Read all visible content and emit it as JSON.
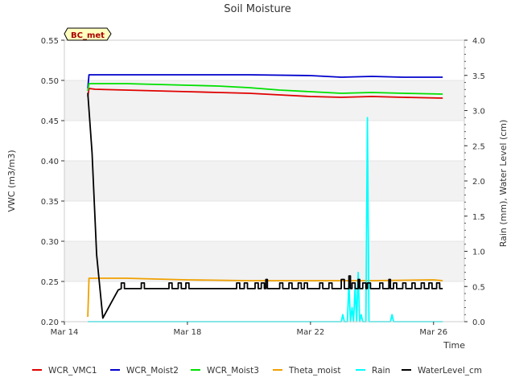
{
  "chart_data": {
    "type": "line",
    "title": "Soil Moisture",
    "xlabel": "Time",
    "ylabel": "VWC (m3/m3)",
    "y2label": "Rain (mm), Water Level (cm)",
    "xlim": [
      0,
      13
    ],
    "ylim": [
      0.2,
      0.55
    ],
    "y2lim": [
      0.0,
      4.0
    ],
    "x_unit": "days from Mar 14",
    "x_ticks": [
      {
        "x": 0,
        "label": "Mar 14"
      },
      {
        "x": 4,
        "label": "Mar 18"
      },
      {
        "x": 8,
        "label": "Mar 22"
      },
      {
        "x": 12,
        "label": "Mar 26"
      }
    ],
    "y_ticks": [
      "0.20",
      "0.25",
      "0.30",
      "0.35",
      "0.40",
      "0.45",
      "0.50",
      "0.55"
    ],
    "y2_ticks": [
      "0.0",
      "0.5",
      "1.0",
      "1.5",
      "2.0",
      "2.5",
      "3.0",
      "3.5",
      "4.0"
    ],
    "grid": "horizontal bands",
    "legend_position": "bottom",
    "badge": "BC_met",
    "series": [
      {
        "name": "WCR_VMC1",
        "color": "#e00000",
        "axis": "left",
        "x": [
          0.76,
          0.8,
          1.0,
          2.0,
          3.0,
          4.0,
          5.0,
          6.0,
          7.0,
          8.0,
          9.0,
          10.0,
          11.0,
          12.3
        ],
        "values": [
          0.48,
          0.49,
          0.489,
          0.488,
          0.487,
          0.486,
          0.485,
          0.484,
          0.482,
          0.48,
          0.479,
          0.48,
          0.479,
          0.478
        ]
      },
      {
        "name": "WCR_Moist2",
        "color": "#0000cc",
        "axis": "left",
        "x": [
          0.76,
          0.8,
          2.0,
          4.0,
          6.0,
          8.0,
          9.0,
          10.0,
          11.0,
          12.3
        ],
        "values": [
          0.49,
          0.507,
          0.507,
          0.507,
          0.507,
          0.506,
          0.504,
          0.505,
          0.504,
          0.504
        ]
      },
      {
        "name": "WCR_Moist3",
        "color": "#00e000",
        "axis": "left",
        "x": [
          0.76,
          0.8,
          2.0,
          3.0,
          4.0,
          5.0,
          6.0,
          7.0,
          8.0,
          9.0,
          10.0,
          11.0,
          12.3
        ],
        "values": [
          0.487,
          0.496,
          0.496,
          0.495,
          0.494,
          0.493,
          0.491,
          0.488,
          0.486,
          0.484,
          0.485,
          0.484,
          0.483
        ]
      },
      {
        "name": "Theta_moist",
        "color": "#f0a000",
        "axis": "left",
        "x": [
          0.76,
          0.8,
          1.0,
          2.0,
          3.0,
          4.0,
          6.0,
          8.0,
          10.0,
          12.0,
          12.3
        ],
        "values": [
          0.206,
          0.254,
          0.254,
          0.254,
          0.253,
          0.252,
          0.251,
          0.251,
          0.251,
          0.252,
          0.251
        ]
      },
      {
        "name": "Rain",
        "color": "#00ffff",
        "axis": "right",
        "x": [
          0.76,
          9.0,
          9.05,
          9.1,
          9.2,
          9.25,
          9.3,
          9.35,
          9.4,
          9.45,
          9.5,
          9.55,
          9.6,
          9.65,
          9.7,
          9.75,
          9.8,
          9.85,
          9.9,
          9.95,
          10.0,
          10.6,
          10.65,
          10.7,
          12.3
        ],
        "values": [
          0.0,
          0.0,
          0.1,
          0.0,
          0.0,
          0.55,
          0.0,
          0.2,
          0.0,
          0.5,
          0.0,
          0.7,
          0.0,
          0.1,
          0.0,
          0.0,
          0.0,
          2.9,
          0.0,
          0.0,
          0.0,
          0.0,
          0.1,
          0.0,
          0.0
        ]
      },
      {
        "name": "WaterLevel_cm",
        "color": "#000000",
        "axis": "right",
        "x": [
          0.76,
          0.9,
          1.05,
          1.25,
          1.5,
          1.75,
          2.0,
          11.0,
          12.3
        ],
        "values": [
          3.25,
          2.4,
          0.95,
          0.05,
          0.25,
          0.45,
          0.47,
          0.47,
          0.47
        ],
        "pulse_base": 0.47,
        "pulses": [
          [
            1.85,
            1.95,
            0.55
          ],
          [
            2.5,
            2.6,
            0.55
          ],
          [
            3.4,
            3.5,
            0.55
          ],
          [
            3.7,
            3.8,
            0.55
          ],
          [
            3.95,
            4.05,
            0.55
          ],
          [
            5.6,
            5.7,
            0.55
          ],
          [
            5.85,
            5.95,
            0.55
          ],
          [
            6.2,
            6.3,
            0.55
          ],
          [
            6.4,
            6.5,
            0.55
          ],
          [
            6.55,
            6.6,
            0.6
          ],
          [
            7.0,
            7.1,
            0.55
          ],
          [
            7.3,
            7.4,
            0.55
          ],
          [
            7.6,
            7.7,
            0.55
          ],
          [
            7.8,
            7.9,
            0.55
          ],
          [
            8.3,
            8.4,
            0.55
          ],
          [
            8.6,
            8.7,
            0.55
          ],
          [
            9.0,
            9.1,
            0.6
          ],
          [
            9.25,
            9.3,
            0.65
          ],
          [
            9.35,
            9.45,
            0.55
          ],
          [
            9.55,
            9.6,
            0.6
          ],
          [
            9.7,
            9.8,
            0.55
          ],
          [
            9.85,
            9.95,
            0.55
          ],
          [
            10.25,
            10.35,
            0.55
          ],
          [
            10.55,
            10.6,
            0.6
          ],
          [
            10.7,
            10.8,
            0.55
          ],
          [
            11.0,
            11.1,
            0.55
          ],
          [
            11.3,
            11.4,
            0.55
          ],
          [
            11.6,
            11.7,
            0.55
          ],
          [
            11.85,
            11.95,
            0.55
          ],
          [
            12.1,
            12.2,
            0.55
          ]
        ]
      }
    ]
  }
}
